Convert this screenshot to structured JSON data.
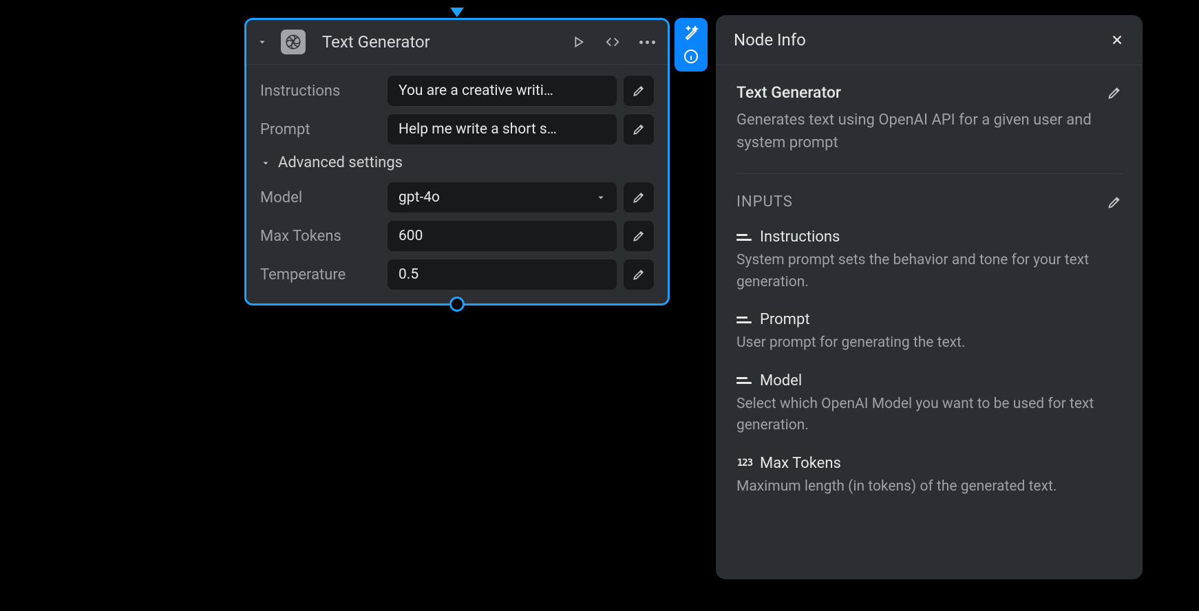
{
  "node": {
    "title": "Text Generator",
    "fields": {
      "instructions": {
        "label": "Instructions",
        "value": "You are a creative writi…"
      },
      "prompt": {
        "label": "Prompt",
        "value": "Help me write a short s…"
      },
      "model": {
        "label": "Model",
        "value": "gpt-4o"
      },
      "max_tokens": {
        "label": "Max Tokens",
        "value": "600"
      },
      "temperature": {
        "label": "Temperature",
        "value": "0.5"
      }
    },
    "advanced_label": "Advanced settings"
  },
  "info": {
    "panel_title": "Node Info",
    "node_name": "Text Generator",
    "node_desc": "Generates text using OpenAI API for a given user and system prompt",
    "inputs_label": "INPUTS",
    "inputs": [
      {
        "type": "text",
        "name": "Instructions",
        "desc": "System prompt sets the behavior and tone for your text generation."
      },
      {
        "type": "text",
        "name": "Prompt",
        "desc": "User prompt for generating the text."
      },
      {
        "type": "text",
        "name": "Model",
        "desc": "Select which OpenAI Model you want to be used for text generation."
      },
      {
        "type": "number",
        "name": "Max Tokens",
        "desc": "Maximum length (in tokens) of the generated text."
      }
    ]
  }
}
